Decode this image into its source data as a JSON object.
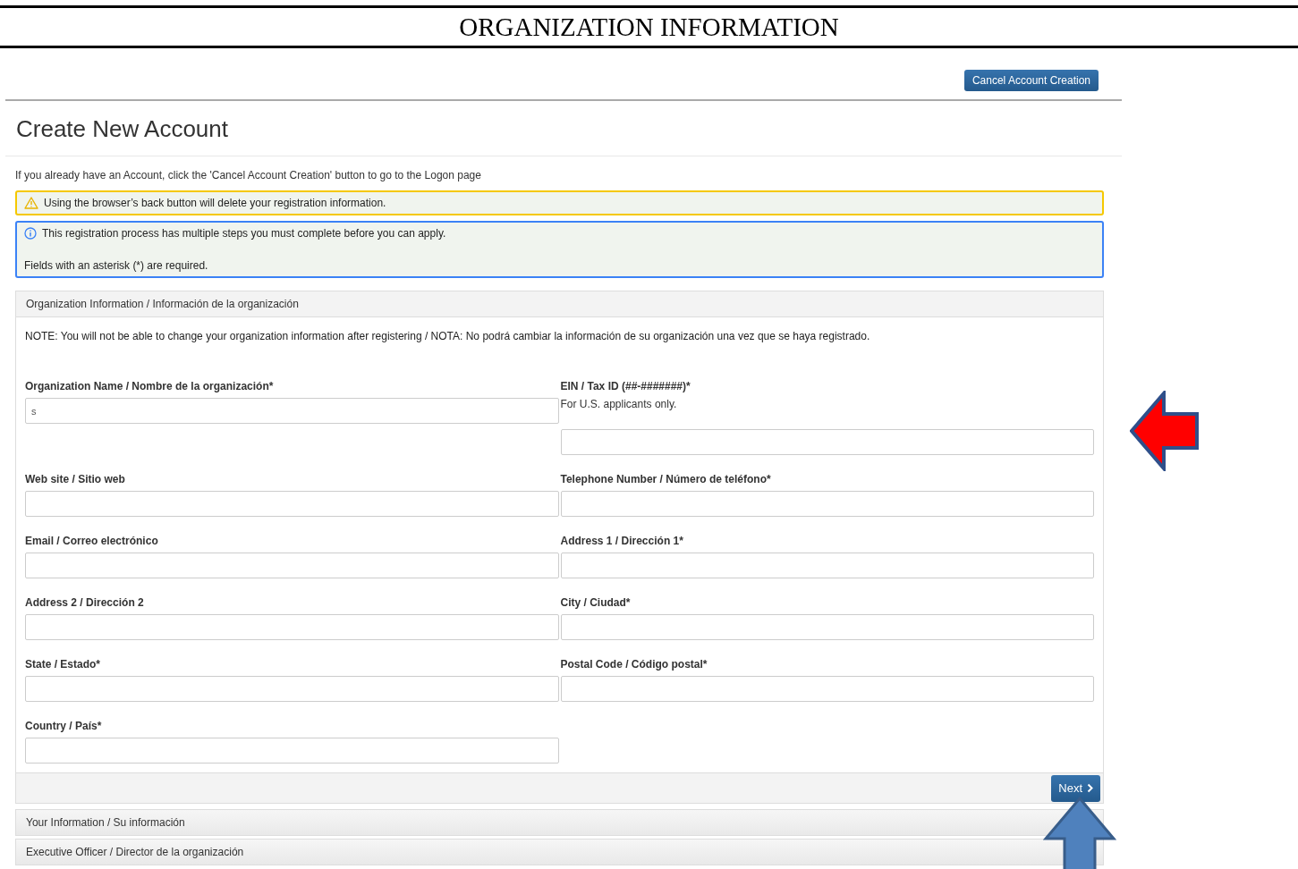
{
  "document_heading": "ORGANIZATION INFORMATION",
  "cancel_button": "Cancel Account Creation",
  "page_title": "Create New Account",
  "intro": "If you already have an Account, click the 'Cancel Account Creation' button to go to the Logon page",
  "alerts": [
    {
      "kind": "warning",
      "lines": [
        "Using the browser’s back button will delete your registration information."
      ]
    },
    {
      "kind": "info",
      "lines": [
        "This registration process has multiple steps you must complete before you can apply.",
        "Fields with an asterisk (*) are required."
      ]
    }
  ],
  "panel": {
    "title": "Organization Information / Información de la organización",
    "note": "NOTE: You will not be able to change your organization information after registering / NOTA: No podrá cambiar la información de su organización una vez que se haya registrado.",
    "fields": [
      {
        "label": "Organization Name / Nombre de la organización*",
        "value": "s"
      },
      {
        "label": "EIN / Tax ID (##-#######)*",
        "hint": "For U.S. applicants only."
      },
      {
        "label": "Web site / Sitio web"
      },
      {
        "label": "Telephone Number / Número de teléfono*"
      },
      {
        "label": "Email / Correo electrónico"
      },
      {
        "label": "Address 1 / Dirección 1*"
      },
      {
        "label": "Address 2 / Dirección 2"
      },
      {
        "label": "City / Ciudad*"
      },
      {
        "label": "State / Estado*"
      },
      {
        "label": "Postal Code / Código postal*"
      },
      {
        "label": "Country / País*"
      }
    ],
    "next_button": "Next"
  },
  "collapsed_sections": [
    "Your Information / Su información",
    "Executive Officer / Director de la organización"
  ]
}
